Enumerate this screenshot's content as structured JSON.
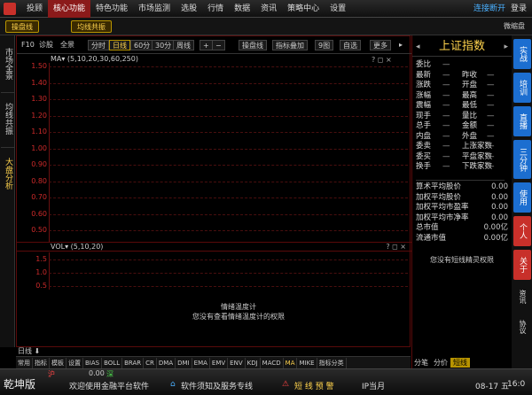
{
  "topbar": {
    "menu": [
      "投顾",
      "核心功能",
      "特色功能",
      "市场监测",
      "选股",
      "行情",
      "数据",
      "资讯",
      "策略中心",
      "设置"
    ],
    "active": 1,
    "connection": "连接断开",
    "login": "登录"
  },
  "subbar": {
    "tabs": [
      "操盘线",
      "均线共振"
    ],
    "mini": "微缩盘"
  },
  "lefttabs": [
    "市场全景",
    "均线共振",
    "大盘分析"
  ],
  "chart_toolbar": {
    "f10": "F10",
    "diag": "诊股",
    "full": "全景",
    "periods": [
      "分时",
      "日线",
      "60分",
      "30分",
      "周线"
    ],
    "period_active": 1,
    "buttons": [
      "操盘线",
      "指标叠加",
      "9图",
      "自选",
      "更多"
    ]
  },
  "chart": {
    "ma_legend": "MA▾ (5,10,20,30,60,250)",
    "y_labels": [
      "1.50",
      "1.40",
      "1.30",
      "1.20",
      "1.10",
      "1.00",
      "0.90",
      "0.80",
      "0.70",
      "0.60",
      "0.50"
    ],
    "vol_legend": "VOL▾ (5,10,20)",
    "vol_labels": [
      "1.5",
      "1.0",
      "0.5"
    ],
    "sentiment_title": "情绪温度计",
    "sentiment_msg": "您没有查看情绪温度计的权限",
    "day_label": "日线",
    "icons": [
      "?",
      "◻",
      "×"
    ]
  },
  "indicators": [
    "常用",
    "指标",
    "模板",
    "设置",
    "BIAS",
    "BOLL",
    "BRAR",
    "CR",
    "DMA",
    "DMI",
    "EMA",
    "EMV",
    "ENV",
    "KDJ",
    "MACD",
    "MA",
    "MIKE",
    "指标分类"
  ],
  "indicator_sel": "MA",
  "panel": {
    "title": "上证指数",
    "rows": [
      {
        "l": "委比",
        "m": "—",
        "r": "",
        "rv": ""
      },
      {
        "l": "最新",
        "m": "—",
        "r": "昨收",
        "rv": "—"
      },
      {
        "l": "涨跌",
        "m": "—",
        "r": "开盘",
        "rv": "—"
      },
      {
        "l": "涨幅",
        "m": "—",
        "r": "最高",
        "rv": "—"
      },
      {
        "l": "震幅",
        "m": "—",
        "r": "最低",
        "rv": "—"
      },
      {
        "l": "现手",
        "m": "—",
        "r": "量比",
        "rv": "—"
      },
      {
        "l": "总手",
        "m": "—",
        "r": "金额",
        "rv": "—"
      },
      {
        "l": "内盘",
        "m": "—",
        "r": "外盘",
        "rv": "—"
      },
      {
        "l": "委卖",
        "m": "—",
        "r": "上涨家数",
        "rv": "—"
      },
      {
        "l": "委买",
        "m": "—",
        "r": "平盘家数",
        "rv": "—"
      },
      {
        "l": "换手",
        "m": "—",
        "r": "下跌家数",
        "rv": "—"
      }
    ],
    "stats": [
      {
        "l": "算术平均股价",
        "v": "0.00"
      },
      {
        "l": "加权平均股价",
        "v": "0.00"
      },
      {
        "l": "加权平均市盈率",
        "v": "0.00"
      },
      {
        "l": "加权平均市净率",
        "v": "0.00"
      },
      {
        "l": "总市值",
        "v": "0.00亿"
      },
      {
        "l": "流通市值",
        "v": "0.00亿"
      }
    ],
    "wizard": "您没有短线精灵权限",
    "tabs": [
      "分笔",
      "分价",
      "短线"
    ],
    "tab_sel": 2
  },
  "sidebar": [
    {
      "t": "实战",
      "c": "blue"
    },
    {
      "t": "培训",
      "c": "blue"
    },
    {
      "t": "直播",
      "c": "blue"
    },
    {
      "t": "三分钟",
      "c": "blue"
    },
    {
      "t": "使用",
      "c": "blue"
    },
    {
      "t": "个人",
      "c": "red"
    },
    {
      "t": "关于",
      "c": "red"
    },
    {
      "t": "资讯",
      "c": "ico"
    },
    {
      "t": "协议",
      "c": "ico"
    }
  ],
  "status": {
    "brand": "乾坤版",
    "sh": "沪",
    "sz_val": "0.00",
    "sz": "深",
    "welcome": "欢迎使用金融平台软件",
    "notice": "软件须知及服务专线",
    "alert": "短 线 预 警",
    "ip": "IP当月",
    "date": "08-17 五",
    "time": "16:0"
  }
}
